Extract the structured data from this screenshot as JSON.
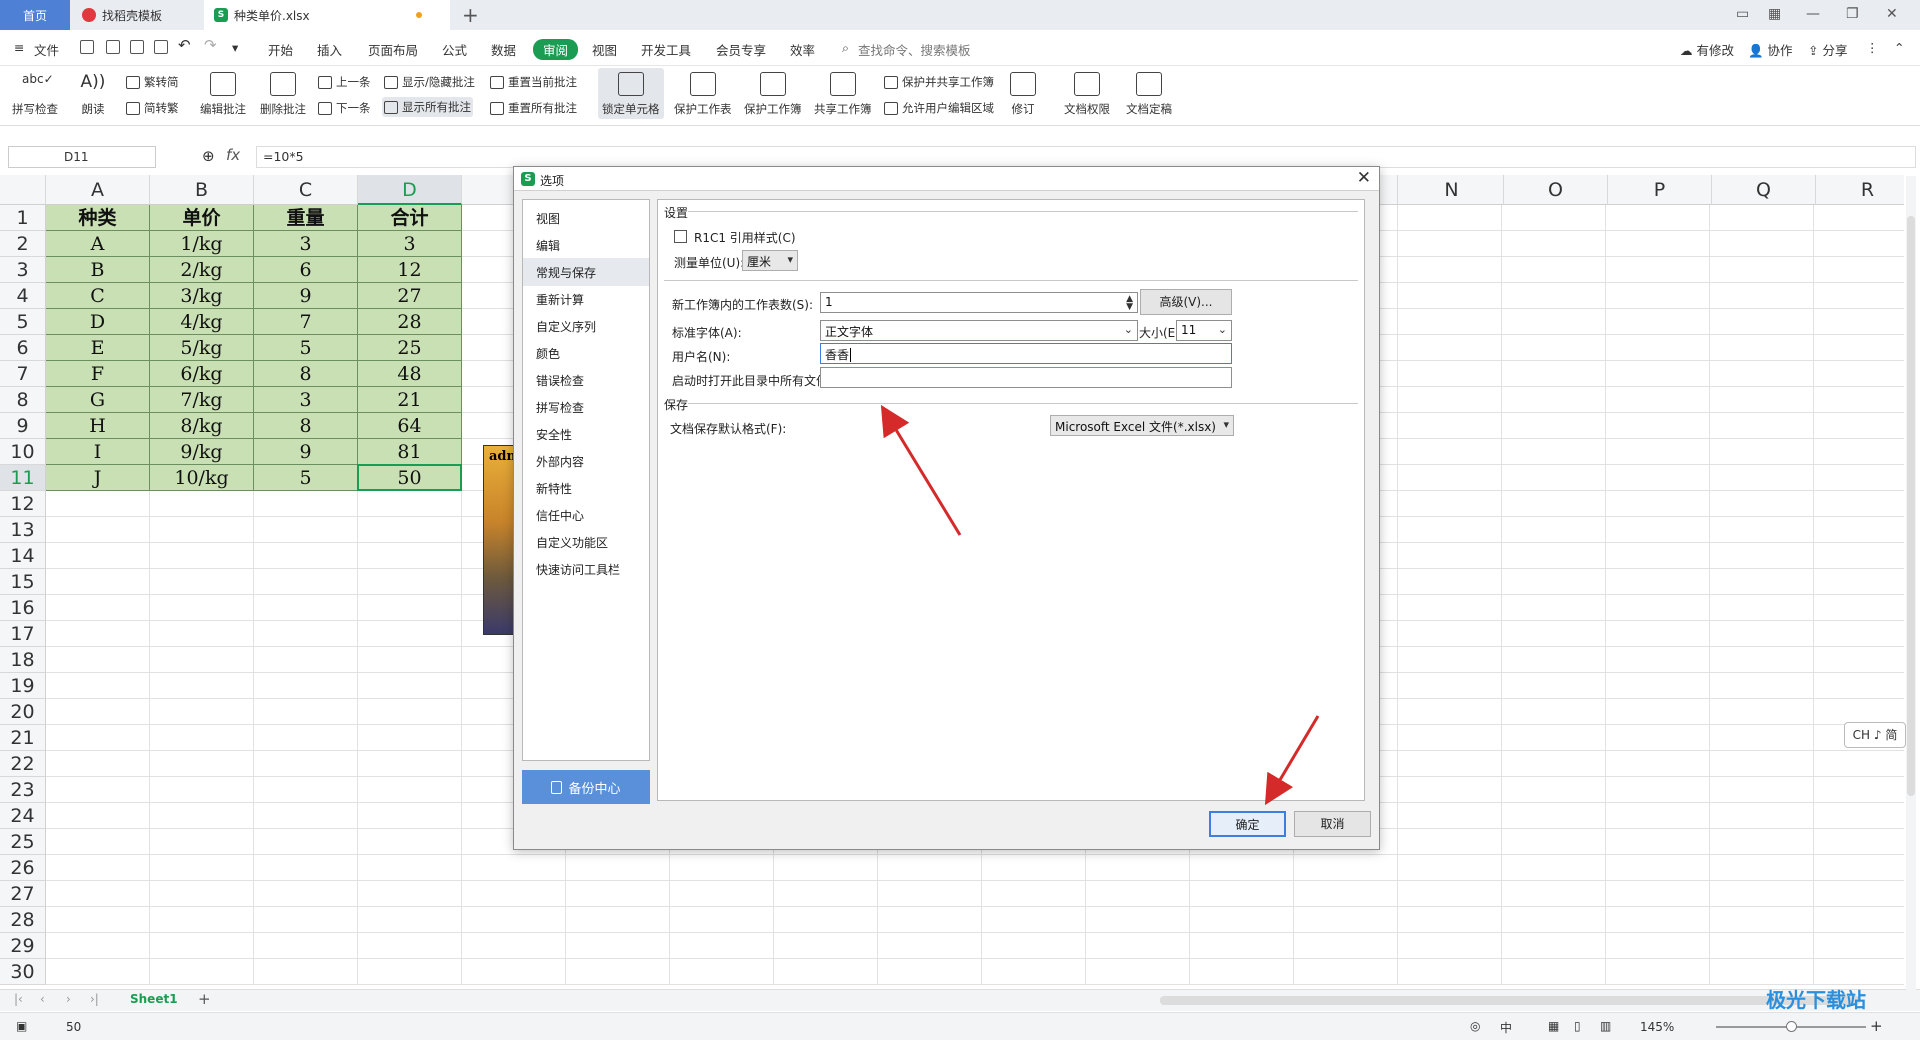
{
  "tabs": {
    "home": "首页",
    "template": "找稻壳模板",
    "file": "种类单价.xlsx"
  },
  "menu": {
    "file": "文件",
    "items": [
      "开始",
      "插入",
      "页面布局",
      "公式",
      "数据",
      "审阅",
      "视图",
      "开发工具",
      "会员专享",
      "效率"
    ],
    "search_placeholder": "查找命令、搜索模板",
    "right": [
      "有修改",
      "协作",
      "分享"
    ]
  },
  "ribbon": {
    "spell_check": "拼写检查",
    "read_aloud": "朗读",
    "trad_to_simp": "繁转简",
    "simp_to_trad": "简转繁",
    "edit_comment": "编辑批注",
    "delete_comment": "删除批注",
    "prev": "上一条",
    "next": "下一条",
    "show_hide_comment": "显示/隐藏批注",
    "show_all_comments": "显示所有批注",
    "reset_current_comment": "重置当前批注",
    "reset_all_comments": "重置所有批注",
    "lock_cell": "锁定单元格",
    "protect_sheet": "保护工作表",
    "protect_workbook": "保护工作簿",
    "share_workbook": "共享工作簿",
    "protect_and_share": "保护并共享工作簿",
    "allow_edit_range": "允许用户编辑区域",
    "revise": "修订",
    "doc_permission": "文档权限",
    "doc_finalize": "文档定稿"
  },
  "formula_bar": {
    "name_box": "D11",
    "fx": "fx",
    "formula": "=10*5"
  },
  "sheet": {
    "columns": [
      "A",
      "B",
      "C",
      "D"
    ],
    "right_columns": [
      "N",
      "O",
      "P",
      "Q",
      "R"
    ],
    "rows": [
      "1",
      "2",
      "3",
      "4",
      "5",
      "6",
      "7",
      "8",
      "9",
      "10",
      "11",
      "12",
      "13",
      "14",
      "15",
      "16",
      "17",
      "18",
      "19",
      "20",
      "21",
      "22",
      "23",
      "24",
      "25",
      "26",
      "27",
      "28",
      "29",
      "30"
    ],
    "header": [
      "种类",
      "单价",
      "重量",
      "合计"
    ],
    "data": [
      [
        "A",
        "1/kg",
        "3",
        "3"
      ],
      [
        "B",
        "2/kg",
        "6",
        "12"
      ],
      [
        "C",
        "3/kg",
        "9",
        "27"
      ],
      [
        "D",
        "4/kg",
        "7",
        "28"
      ],
      [
        "E",
        "5/kg",
        "5",
        "25"
      ],
      [
        "F",
        "6/kg",
        "8",
        "48"
      ],
      [
        "G",
        "7/kg",
        "3",
        "21"
      ],
      [
        "H",
        "8/kg",
        "8",
        "64"
      ],
      [
        "I",
        "9/kg",
        "9",
        "81"
      ],
      [
        "J",
        "10/kg",
        "5",
        "50"
      ]
    ],
    "comment_author": "adm",
    "sheet_tab": "Sheet1"
  },
  "dialog": {
    "title": "选项",
    "nav": [
      "视图",
      "编辑",
      "常规与保存",
      "重新计算",
      "自定义序列",
      "颜色",
      "错误检查",
      "拼写检查",
      "安全性",
      "外部内容",
      "新特性",
      "信任中心",
      "自定义功能区",
      "快速访问工具栏"
    ],
    "backup": "备份中心",
    "settings_title": "设置",
    "r1c1_label": "R1C1 引用样式(C)",
    "unit_label": "测量单位(U):",
    "unit_value": "厘米",
    "sheets_label": "新工作簿内的工作表数(S):",
    "sheets_value": "1",
    "advanced_btn": "高级(V)...",
    "font_label": "标准字体(A):",
    "font_value": "正文字体",
    "size_label": "大小(E):",
    "size_value": "11",
    "username_label": "用户名(N):",
    "username_value": "香香",
    "startup_label": "启动时打开此目录中所有文件(O):",
    "startup_value": "",
    "save_title": "保存",
    "save_format_label": "文档保存默认格式(F):",
    "save_format_value": "Microsoft Excel 文件(*.xlsx)",
    "ok": "确定",
    "cancel": "取消"
  },
  "status": {
    "value": "50",
    "zoom": "145%",
    "ime": "CH ♪ 简",
    "watermark": "极光下载站"
  },
  "colors": {
    "accent": "#1a9d52",
    "cell_fill": "#c9e0b4",
    "arrow": "#d42a2a",
    "home_tab": "#4e80d6"
  }
}
